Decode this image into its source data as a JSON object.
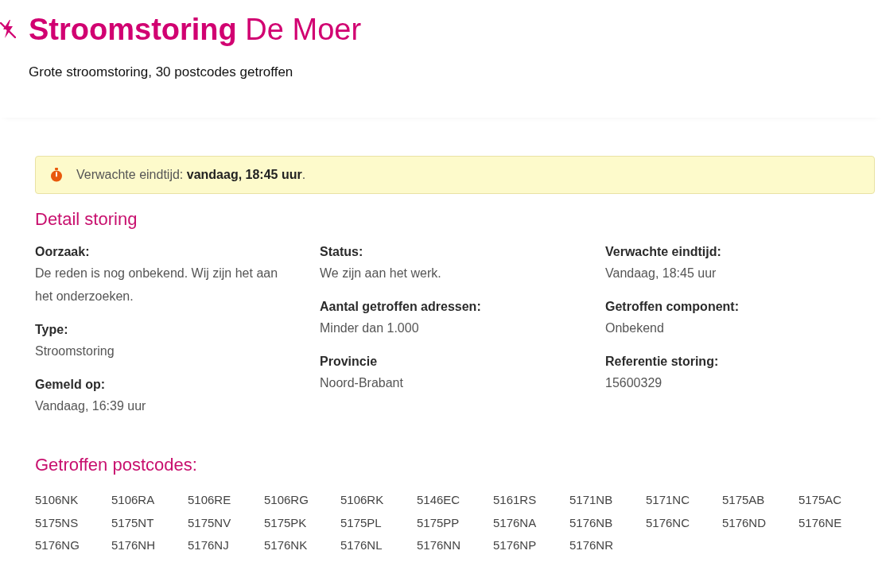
{
  "header": {
    "title": "**Stroomstoring** De Moer",
    "subtitle": "Grote stroomstoring, 30 postcodes getroffen"
  },
  "notice": {
    "text": "Verwachte eindtijd: **vandaag, 18:45 uur**."
  },
  "details": {
    "heading": "Detail storing",
    "columns": [
      [
        {
          "label": "Oorzaak:",
          "value": "De reden is nog onbekend. Wij zijn het aan het onderzoeken."
        },
        {
          "label": "Type:",
          "value": "Stroomstoring"
        },
        {
          "label": "Gemeld op:",
          "value": "Vandaag, 16:39 uur"
        }
      ],
      [
        {
          "label": "Status:",
          "value": "We zijn aan het werk."
        },
        {
          "label": "Aantal getroffen adressen:",
          "value": "Minder dan 1.000"
        },
        {
          "label": "Provincie",
          "value": "Noord-Brabant"
        }
      ],
      [
        {
          "label": "Verwachte eindtijd:",
          "value": "Vandaag, 18:45 uur"
        },
        {
          "label": "Getroffen component:",
          "value": "Onbekend"
        },
        {
          "label": "Referentie storing:",
          "value": "15600329"
        }
      ]
    ]
  },
  "postcodes": {
    "heading": "Getroffen postcodes:",
    "items": [
      "5106NK",
      "5106RA",
      "5106RE",
      "5106RG",
      "5106RK",
      "5146EC",
      "5161RS",
      "5171NB",
      "5171NC",
      "5175AB",
      "5175AC",
      "5175NS",
      "5175NT",
      "5175NV",
      "5175PK",
      "5175PL",
      "5175PP",
      "5176NA",
      "5176NB",
      "5176NC",
      "5176ND",
      "5176NE",
      "5176NG",
      "5176NH",
      "5176NJ",
      "5176NK",
      "5176NL",
      "5176NN",
      "5176NP",
      "5176NR"
    ]
  }
}
